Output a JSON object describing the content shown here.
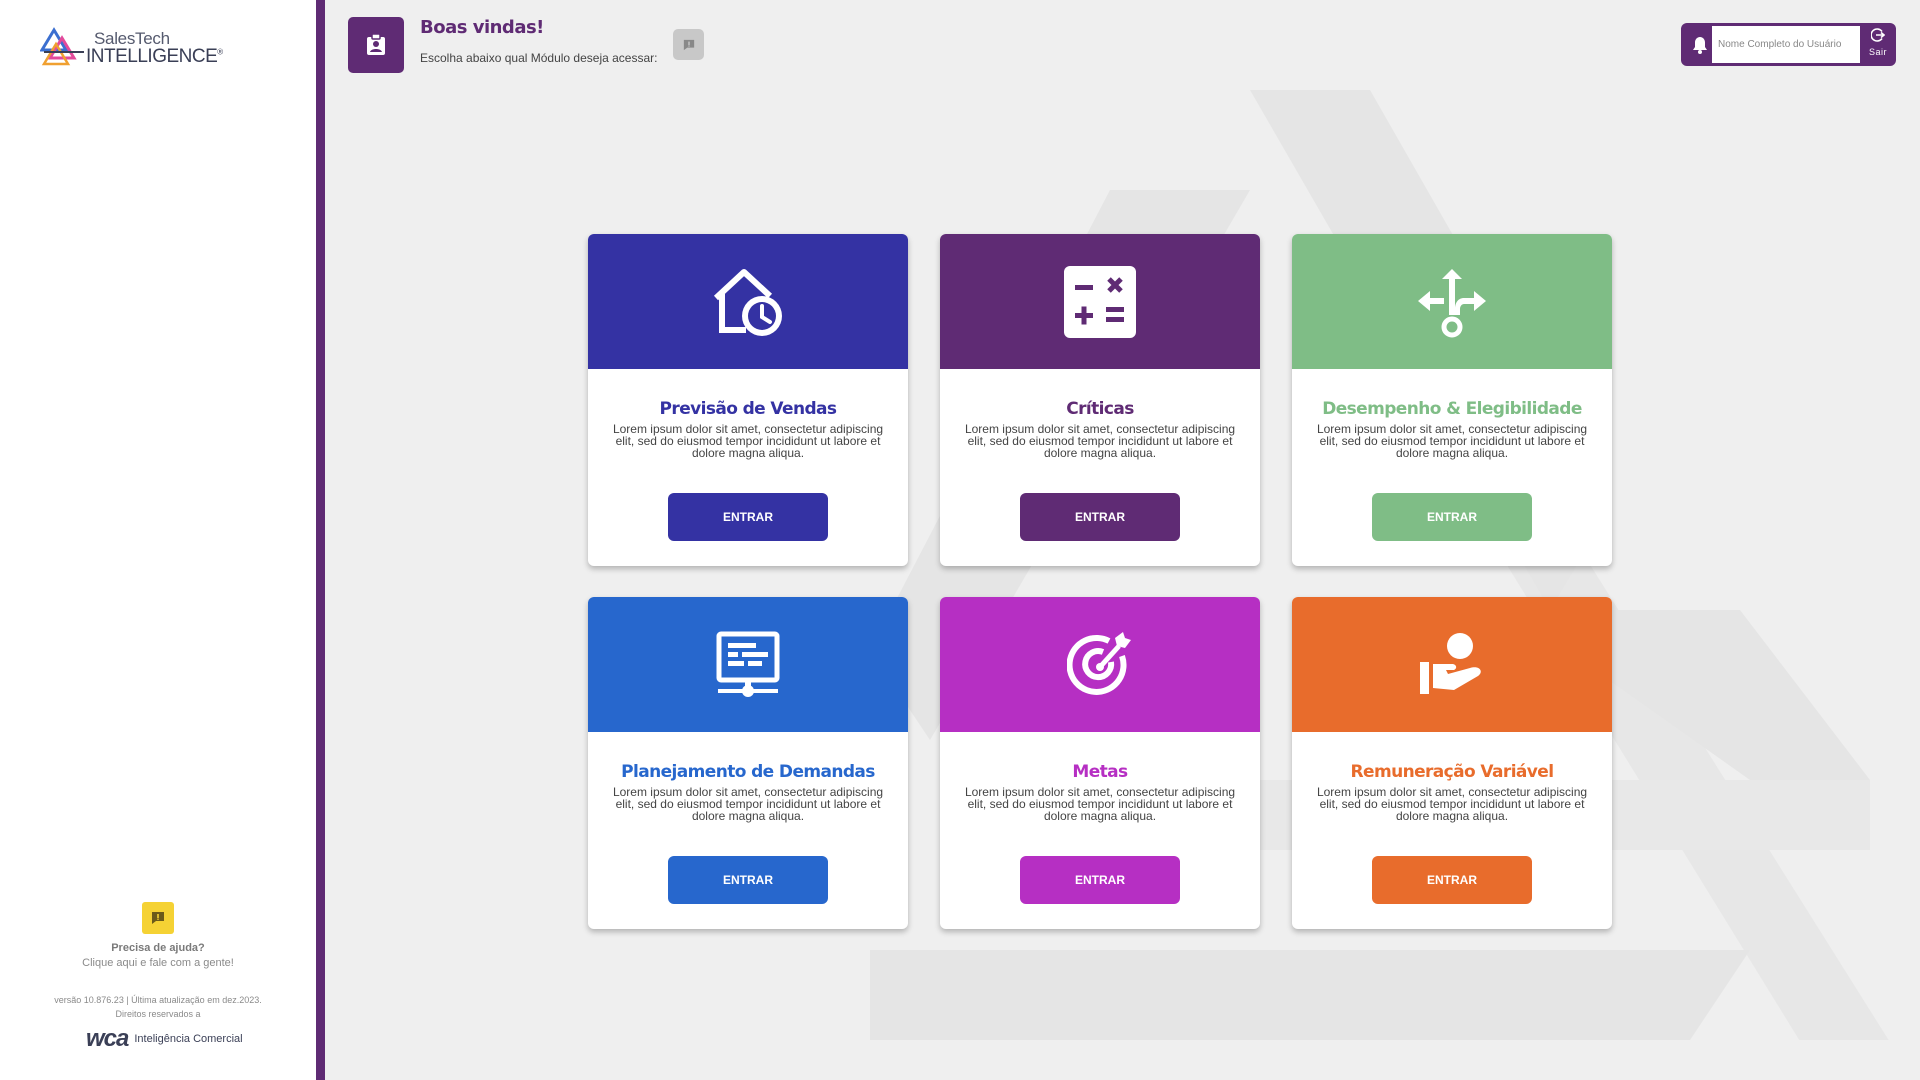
{
  "brand": {
    "logo_line1": "SalesTech",
    "logo_line2": "INTELLIGENCE",
    "logo_reg": "®"
  },
  "header": {
    "welcome": "Boas vindas!",
    "subtitle": "Escolha abaixo qual Módulo deseja acessar:",
    "username_placeholder": "Nome Completo do Usuário",
    "logout_label": "Sair"
  },
  "sidebar": {
    "help_title": "Precisa de ajuda?",
    "help_sub": "Clique aqui e fale com a gente!",
    "version_line1": "versão 10.876.23 | Última atualização em dez.2023.",
    "version_line2": "Direitos reservados a",
    "wca_logo": "wca",
    "wca_sub": "Inteligência Comercial"
  },
  "colors": {
    "primary": "#5f2b74",
    "help_yellow": "#f5d234"
  },
  "modules": [
    {
      "title": "Previsão de Vendas",
      "desc": "Lorem ipsum dolor sit amet, consectetur adipiscing elit, sed do eiusmod tempor incididunt ut labore et dolore magna aliqua.",
      "button": "ENTRAR",
      "color": "#3432a3",
      "icon": "home-clock-icon"
    },
    {
      "title": "Críticas",
      "desc": "Lorem ipsum dolor sit amet, consectetur adipiscing elit, sed do eiusmod tempor incididunt ut labore et dolore magna aliqua.",
      "button": "ENTRAR",
      "color": "#5f2b74",
      "icon": "calculator-icon"
    },
    {
      "title": "Desempenho & Elegibilidade",
      "desc": "Lorem ipsum dolor sit amet, consectetur adipiscing elit, sed do eiusmod tempor incididunt ut labore et dolore magna aliqua.",
      "button": "ENTRAR",
      "color": "#7fbd86",
      "icon": "split-arrows-icon"
    },
    {
      "title": "Planejamento de Demandas",
      "desc": "Lorem ipsum dolor sit amet, consectetur adipiscing elit, sed do eiusmod tempor incididunt ut labore et dolore magna aliqua.",
      "button": "ENTRAR",
      "color": "#2767cd",
      "icon": "monitor-network-icon"
    },
    {
      "title": "Metas",
      "desc": "Lorem ipsum dolor sit amet, consectetur adipiscing elit, sed do eiusmod tempor incididunt ut labore et dolore magna aliqua.",
      "button": "ENTRAR",
      "color": "#b62fc3",
      "icon": "target-icon"
    },
    {
      "title": "Remuneração Variável",
      "desc": "Lorem ipsum dolor sit amet, consectetur adipiscing elit, sed do eiusmod tempor incididunt ut labore et dolore magna aliqua.",
      "button": "ENTRAR",
      "color": "#e86c2c",
      "icon": "hand-person-icon"
    }
  ]
}
